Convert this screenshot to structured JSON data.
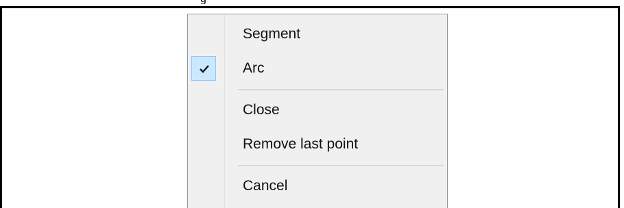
{
  "context_menu": {
    "items": [
      {
        "label": "Segment",
        "checked": false
      },
      {
        "label": "Arc",
        "checked": true
      },
      {
        "label": "Close",
        "checked": false
      },
      {
        "label": "Remove last point",
        "checked": false
      },
      {
        "label": "Cancel",
        "checked": false
      }
    ],
    "check_icon": "checkmark-icon"
  },
  "colors": {
    "menu_background": "#f0f0f0",
    "check_highlight": "#cce8ff",
    "check_border": "#90c8f6",
    "frame_border": "#000000"
  }
}
